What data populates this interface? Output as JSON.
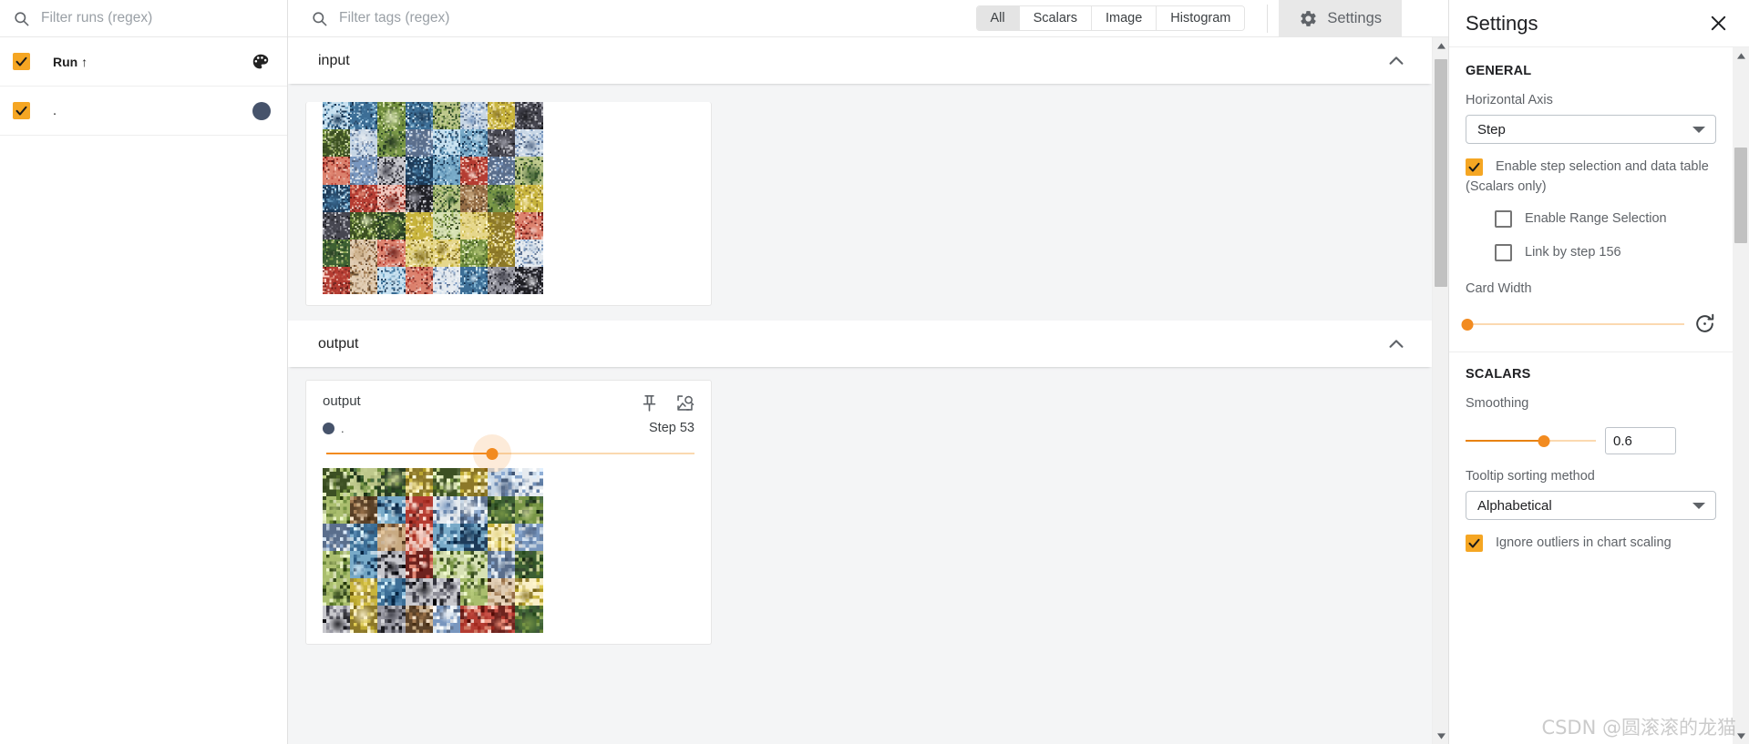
{
  "sidebar": {
    "run_filter_placeholder": "Filter runs (regex)",
    "header_label": "Run ↑",
    "rows": [
      {
        "label": "Run ↑",
        "icon": "palette-icon",
        "checked": true
      },
      {
        "label": ".",
        "icon": "color-dot",
        "color": "#46536b",
        "checked": true
      }
    ]
  },
  "topbar": {
    "tag_filter_placeholder": "Filter tags (regex)",
    "tabs": [
      {
        "label": "All",
        "active": true
      },
      {
        "label": "Scalars",
        "active": false
      },
      {
        "label": "Image",
        "active": false
      },
      {
        "label": "Histogram",
        "active": false
      }
    ],
    "settings_label": "Settings"
  },
  "main": {
    "groups": [
      {
        "title": "input",
        "expanded": true
      },
      {
        "title": "output",
        "expanded": true
      }
    ],
    "output_card": {
      "title": "output",
      "run_label": ".",
      "run_color": "#46536b",
      "step_label": "Step 53",
      "step_percent": 45,
      "pin_icon": "pin-icon",
      "open_image_icon": "image-search-icon"
    }
  },
  "settings": {
    "title": "Settings",
    "general_heading": "GENERAL",
    "horizontal_axis_label": "Horizontal Axis",
    "horizontal_axis_value": "Step",
    "enable_step_selection_label": "Enable step selection and data table",
    "enable_step_selection_checked": true,
    "scalars_only_note": "(Scalars only)",
    "enable_range_selection_label": "Enable Range Selection",
    "enable_range_selection_checked": false,
    "link_by_step_label": "Link by step 156",
    "link_by_step_checked": false,
    "card_width_label": "Card Width",
    "card_width_percent": 1,
    "scalars_heading": "SCALARS",
    "smoothing_label": "Smoothing",
    "smoothing_value": "0.6",
    "smoothing_percent": 60,
    "tooltip_sorting_label": "Tooltip sorting method",
    "tooltip_sorting_value": "Alphabetical",
    "ignore_outliers_label": "Ignore outliers in chart scaling",
    "ignore_outliers_checked": true
  },
  "watermark": "CSDN @圆滚滚的龙猫",
  "colors": {
    "accent": "#f5a623",
    "slider": "#f28b20",
    "run_dot": "#46536b"
  }
}
